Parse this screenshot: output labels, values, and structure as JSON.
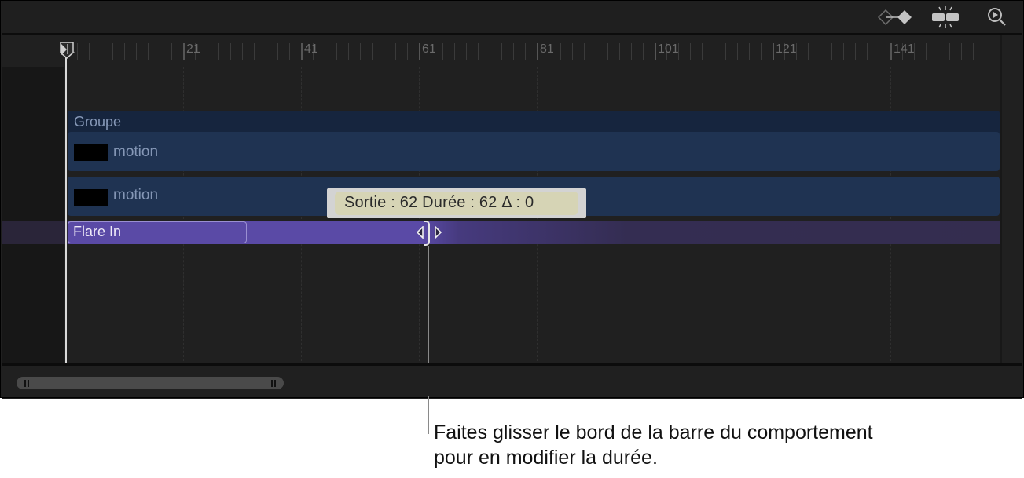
{
  "toolbar": {
    "icons": [
      {
        "name": "keyframe-navigation-icon"
      },
      {
        "name": "snapping-icon"
      },
      {
        "name": "zoom-to-fit-icon"
      }
    ]
  },
  "ruler": {
    "labels": [
      "1",
      "21",
      "41",
      "61",
      "81",
      "101",
      "121",
      "141"
    ],
    "first_frame": 1,
    "last_visible_frame": 156,
    "label_interval": 20,
    "minor_tick_interval": 2
  },
  "playhead": {
    "frame": 1
  },
  "tracks": {
    "group": {
      "label": "Groupe",
      "color": "#16253e"
    },
    "layers": [
      {
        "label": "motion",
        "color": "#1f3352"
      },
      {
        "label": "motion",
        "color": "#1f3352"
      }
    ],
    "behavior": {
      "label": "Flare In",
      "out_frame": 62,
      "color": "#5a4aa6"
    }
  },
  "tooltip": {
    "text": "Sortie : 62 Durée : 62 Δ : 0"
  },
  "scrollbar": {
    "visible_fraction": 0.27
  },
  "caption": {
    "line1": "Faites glisser le bord de la barre du comportement",
    "line2": "pour en modifier la durée."
  }
}
